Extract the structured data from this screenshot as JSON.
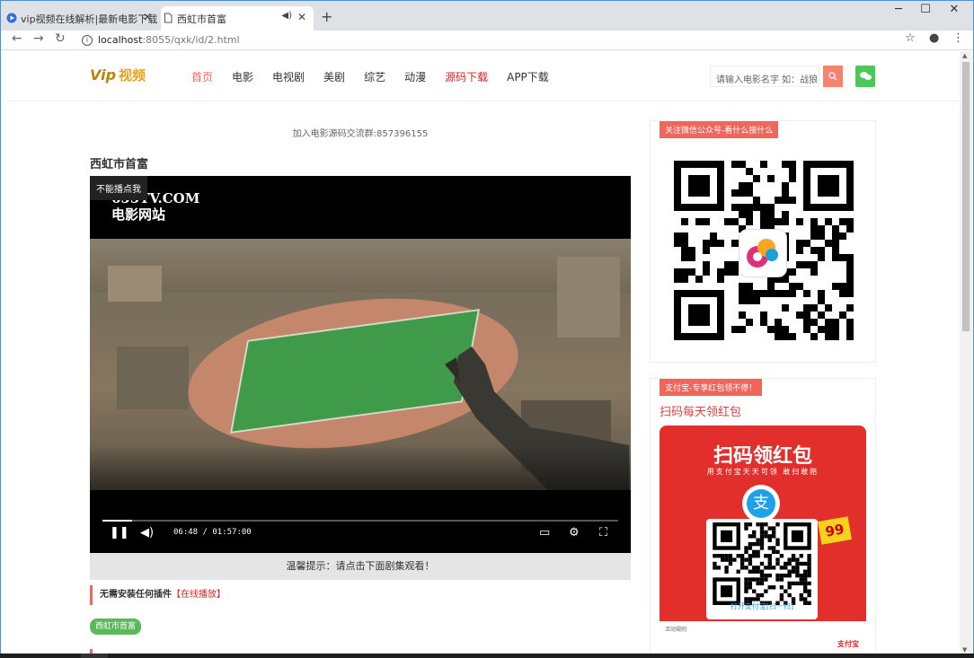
{
  "browser": {
    "tabs": [
      {
        "title": "vip视频在线解析|最新电影下载",
        "active": false
      },
      {
        "title": "西虹市首富",
        "active": true
      }
    ],
    "url_host": "localhost",
    "url_path": ":8055/qxk/id/2.html"
  },
  "site": {
    "logo_text": "视频",
    "nav": [
      "首页",
      "电影",
      "电视剧",
      "美剧",
      "综艺",
      "动漫",
      "源码下载",
      "APP下载"
    ],
    "search_placeholder": "请输入电影名字 如：战狼"
  },
  "main": {
    "qq_group": "加入电影源码交流群:857396155",
    "title": "西虹市首富",
    "player": {
      "cannot_play": "不能播点我",
      "watermark_line1": "655TV.COM",
      "watermark_line2": "电影网站",
      "current_time": "06:48",
      "duration": "01:57:00",
      "progress_fraction": 0.058
    },
    "tip": "温馨提示：请点击下面剧集观看！",
    "play_note": "无需安装任何插件",
    "play_note_link": "【在线播放】",
    "episode": "西虹市首富"
  },
  "sidebar": {
    "wechat_badge": "关注微信公众号-看什么搜什么",
    "alipay_badge": "支付宝-专享红包领不停！",
    "alipay_title": "扫码每天领红包",
    "redpack_title": "扫码领红包",
    "redpack_sub": "用支付宝天天可领 敢扫敢赔",
    "price_tag": "99",
    "scan_text": "打开支付宝[扫一扫]",
    "footer_text": "活动规则",
    "alipay_logo": "支付宝"
  },
  "colors": {
    "accent": "#f0665b",
    "green": "#5cb85c",
    "alipay_red": "#e32f2b"
  }
}
